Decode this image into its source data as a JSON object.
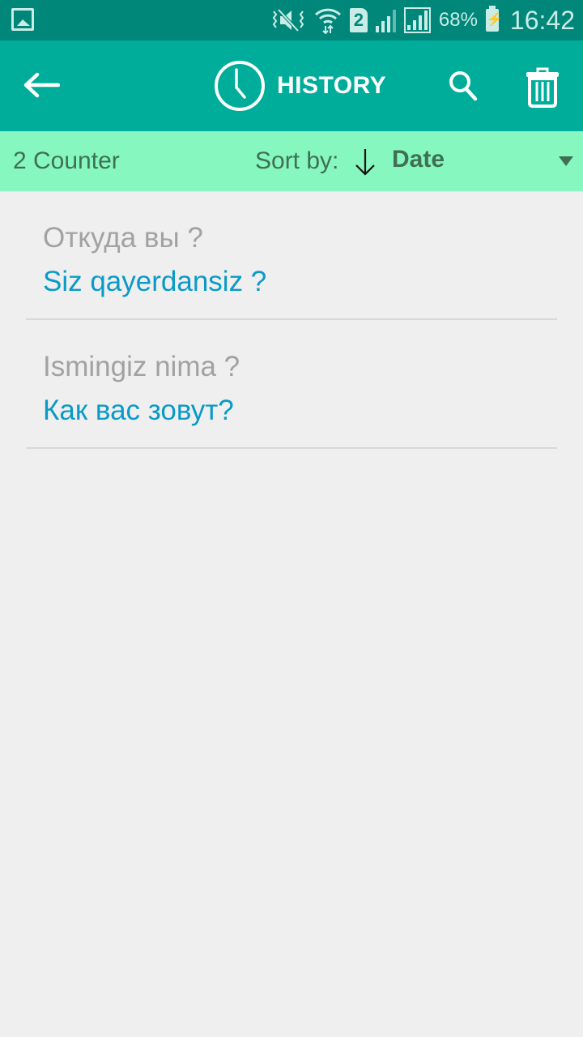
{
  "status_bar": {
    "notification_icon": "image-icon",
    "icons": [
      "vibrate-mute-icon",
      "wifi-data-icon",
      "sim-2-icon",
      "signal-icon",
      "signal-boxed-icon"
    ],
    "sim_label": "2",
    "battery_percent": "68%",
    "battery_charging": true,
    "time": "16:42"
  },
  "app_bar": {
    "back_icon": "arrow-left-icon",
    "title_icon": "clock-icon",
    "title": "HISTORY",
    "search_icon": "search-icon",
    "delete_icon": "trash-icon"
  },
  "sort_bar": {
    "counter": "2 Counter",
    "sort_label": "Sort by:",
    "sort_direction": "descending",
    "sort_value": "Date"
  },
  "history": [
    {
      "source": "Откуда вы ?",
      "translation": "Siz qayerdansiz ?"
    },
    {
      "source": "Ismingiz nima ?",
      "translation": "Как вас зовут?"
    }
  ],
  "colors": {
    "status_bar": "#00877a",
    "app_bar": "#00ad9a",
    "sort_bar": "#86f7be",
    "source_text": "#a2a2a2",
    "translation_text": "#0a9ac7",
    "background": "#efefef"
  }
}
